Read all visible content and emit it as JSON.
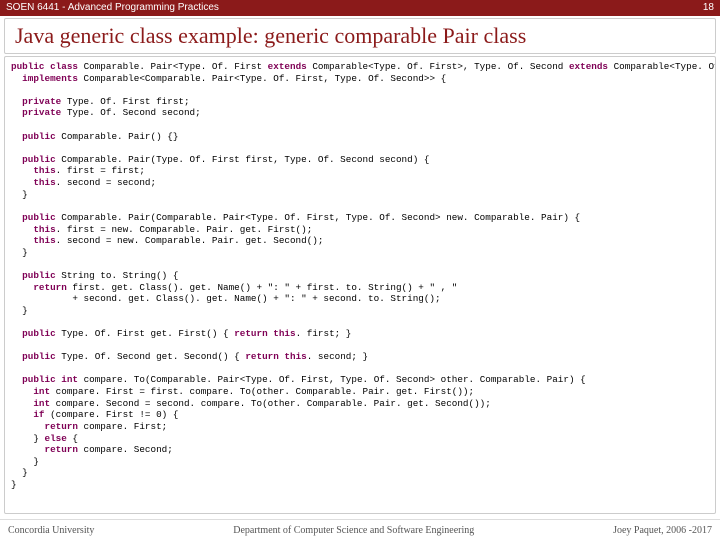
{
  "header": {
    "course": "SOEN 6441 - Advanced Programming Practices",
    "page": "18"
  },
  "title": "Java generic class example: generic comparable Pair class",
  "code": {
    "l1a": "public",
    "l1b": "class",
    "l1c": " Comparable. Pair<Type. Of. First ",
    "l1d": "extends",
    "l1e": " Comparable<Type. Of. First>, Type. Of. Second ",
    "l1f": "extends",
    "l1g": " Comparable<Type. Of. Second>>",
    "l2a": "implements",
    "l2b": " Comparable<Comparable. Pair<Type. Of. First, Type. Of. Second>> {",
    "l3a": "private",
    "l3b": " Type. Of. First first;",
    "l4a": "private",
    "l4b": " Type. Of. Second second;",
    "l5a": "public",
    "l5b": " Comparable. Pair() {}",
    "l6a": "public",
    "l6b": " Comparable. Pair(Type. Of. First first, Type. Of. Second second) {",
    "l7a": "this",
    "l7b": ". first = first;",
    "l8a": "this",
    "l8b": ". second = second;",
    "l9": "  }",
    "l10a": "public",
    "l10b": " Comparable. Pair(Comparable. Pair<Type. Of. First, Type. Of. Second> new. Comparable. Pair) {",
    "l11a": "this",
    "l11b": ". first = new. Comparable. Pair. get. First();",
    "l12a": "this",
    "l12b": ". second = new. Comparable. Pair. get. Second();",
    "l13": "  }",
    "l14a": "public",
    "l14b": " String to. String() {",
    "l15a": "return",
    "l15b": " first. get. Class(). get. Name() + \": \" + first. to. String() + \" , \"",
    "l16": "           + second. get. Class(). get. Name() + \": \" + second. to. String();",
    "l17": "  }",
    "l18a": "public",
    "l18b": " Type. Of. First get. First() { ",
    "l18c": "return",
    "l18d": "this",
    "l18e": ". first; }",
    "l19a": "public",
    "l19b": " Type. Of. Second get. Second() { ",
    "l19c": "return",
    "l19d": "this",
    "l19e": ". second; }",
    "l20a": "public",
    "l20b": "int",
    "l20c": " compare. To(Comparable. Pair<Type. Of. First, Type. Of. Second> other. Comparable. Pair) {",
    "l21a": "int",
    "l21b": " compare. First = first. compare. To(other. Comparable. Pair. get. First());",
    "l22a": "int",
    "l22b": " compare. Second = second. compare. To(other. Comparable. Pair. get. Second());",
    "l23a": "if",
    "l23b": " (compare. First != 0) {",
    "l24a": "return",
    "l24b": " compare. First;",
    "l25a": "else",
    "l25b": " {",
    "l26a": "return",
    "l26b": " compare. Second;",
    "l27": "    }",
    "l28": "  }",
    "l29": "}"
  },
  "footer": {
    "left": "Concordia University",
    "center": "Department of Computer Science and Software Engineering",
    "right": "Joey Paquet, 2006 -2017"
  }
}
